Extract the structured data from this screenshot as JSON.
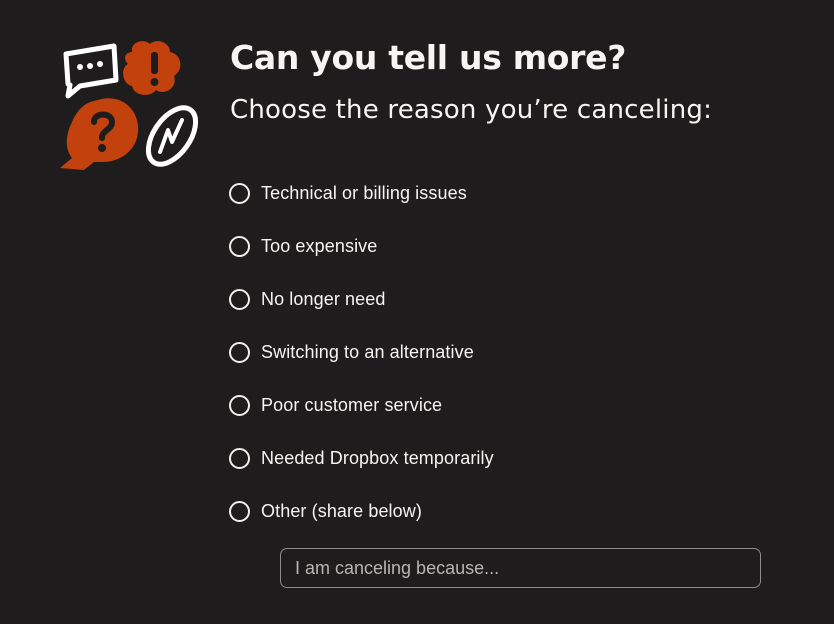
{
  "heading": "Can you tell us more?",
  "subheading": "Choose the reason you’re canceling:",
  "illustration": {
    "icons": [
      "speech-bubble-dots-icon",
      "exclamation-bubble-icon",
      "question-bubble-icon",
      "squiggle-circle-icon"
    ],
    "accent_color": "#c2410c",
    "stroke_color": "#ffffff"
  },
  "options": [
    {
      "label": "Technical or billing issues",
      "selected": false
    },
    {
      "label": "Too expensive",
      "selected": false
    },
    {
      "label": "No longer need",
      "selected": false
    },
    {
      "label": "Switching to an alternative",
      "selected": false
    },
    {
      "label": "Poor customer service",
      "selected": false
    },
    {
      "label": "Needed Dropbox temporarily",
      "selected": false
    },
    {
      "label": "Other (share below)",
      "selected": false
    }
  ],
  "reason_input": {
    "value": "",
    "placeholder": "I am canceling because..."
  },
  "colors": {
    "background": "#1e1c1c",
    "text": "#f7f5f2",
    "accent": "#c2410c"
  }
}
